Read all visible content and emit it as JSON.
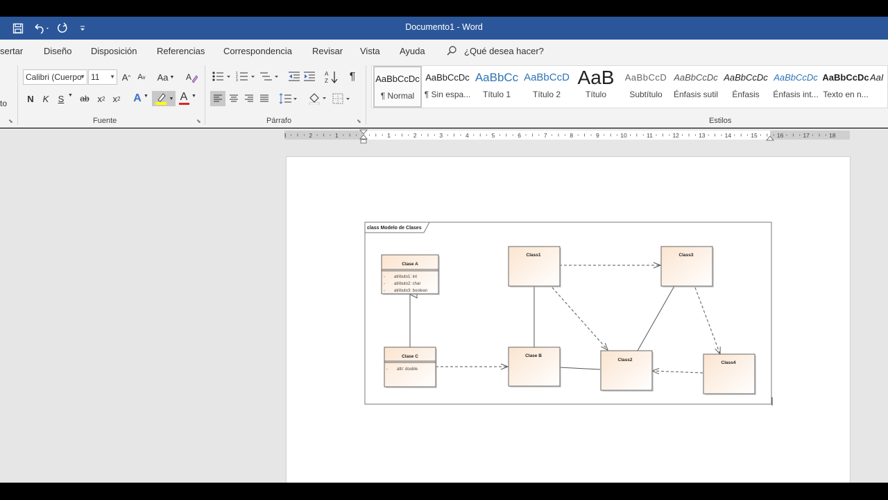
{
  "window": {
    "title": "Documento1  -  Word"
  },
  "quick_access": {
    "icons": [
      "save-icon",
      "undo-icon",
      "redo-icon",
      "customize-icon"
    ]
  },
  "menu": {
    "tabs": [
      "sertar",
      "Diseño",
      "Disposición",
      "Referencias",
      "Correspondencia",
      "Revisar",
      "Vista",
      "Ayuda"
    ],
    "search_placeholder": "¿Qué desea hacer?"
  },
  "ribbon": {
    "left_cut_label": "to",
    "font": {
      "label": "Fuente",
      "font_name": "Calibri (Cuerpo",
      "font_size": "11",
      "grow": "A",
      "shrink": "A",
      "case": "Aa",
      "bold": "N",
      "italic": "K",
      "underline": "S",
      "strike": "ab",
      "subscript": "x",
      "superscript": "x",
      "effects": "A",
      "color": "A"
    },
    "paragraph": {
      "label": "Párrafo",
      "pilcrow": "¶"
    },
    "styles": {
      "label": "Estilos",
      "items": [
        {
          "preview": "AaBbCcDc",
          "name": "¶ Normal"
        },
        {
          "preview": "AaBbCcDc",
          "name": "¶ Sin espa..."
        },
        {
          "preview": "AaBbCc",
          "name": "Título 1"
        },
        {
          "preview": "AaBbCcD",
          "name": "Título 2"
        },
        {
          "preview": "AaB",
          "name": "Título"
        },
        {
          "preview": "AaBbCcD",
          "name": "Subtítulo"
        },
        {
          "preview": "AaBbCcDc",
          "name": "Énfasis sutil"
        },
        {
          "preview": "AaBbCcDc",
          "name": "Énfasis"
        },
        {
          "preview": "AaBbCcDc",
          "name": "Énfasis int..."
        },
        {
          "preview": "AaBbCcDc",
          "name": "Texto en n..."
        },
        {
          "preview": "AaI",
          "name": ""
        }
      ]
    }
  },
  "ruler": {
    "labels": [
      "3",
      "2",
      "1",
      "1",
      "2",
      "3",
      "4",
      "5",
      "6",
      "7",
      "8",
      "9",
      "10",
      "11",
      "12",
      "13",
      "14",
      "15",
      "16",
      "17",
      "18"
    ]
  },
  "diagram": {
    "frame_title": "class Modelo de Clases",
    "classes": [
      {
        "name": "Clase A",
        "attributes": [
          "atributo1: int",
          "atributo2: char",
          "atributo3: boolean"
        ]
      },
      {
        "name": "Clase C",
        "attributes": [
          "attr: double"
        ]
      },
      {
        "name": "Class1",
        "attributes": []
      },
      {
        "name": "Class3",
        "attributes": []
      },
      {
        "name": "Clase B",
        "attributes": []
      },
      {
        "name": "Class2",
        "attributes": []
      },
      {
        "name": "Class4",
        "attributes": []
      }
    ],
    "attr_prefix": "-",
    "colors": {
      "box_top": "#fbe9da",
      "box_bottom": "#ffffff",
      "border": "#666666"
    }
  },
  "colors": {
    "title_bar": "#2b579a",
    "highlight": "#ffff00",
    "font_color": "#d9252a"
  }
}
